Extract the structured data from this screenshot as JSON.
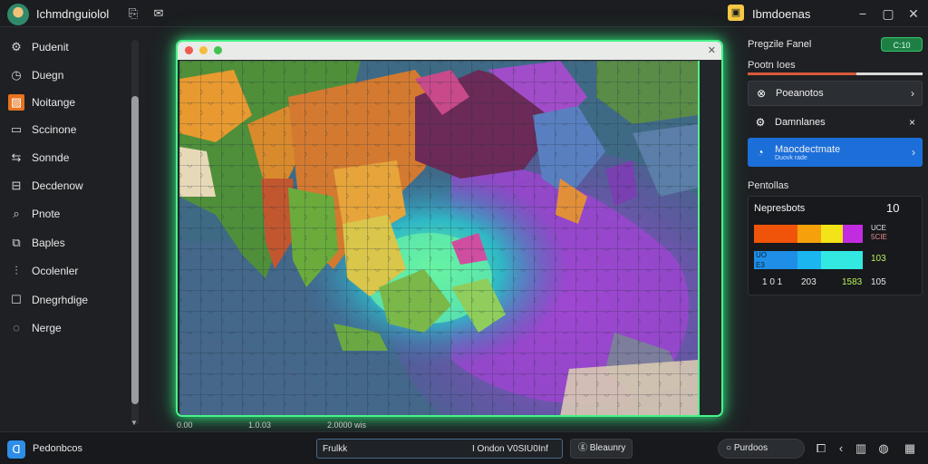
{
  "app": {
    "title": "Ichmdnguiolol",
    "logo_icon": "avatar-icon"
  },
  "right_header": {
    "title": "Ibmdoenas",
    "icon": "folder-icon"
  },
  "sidebar": {
    "items": [
      {
        "label": "Pudenit",
        "icon": "gear-icon"
      },
      {
        "label": "Duegn",
        "icon": "clock-icon"
      },
      {
        "label": "Noitange",
        "icon": "image-icon",
        "active": true
      },
      {
        "label": "Sccinone",
        "icon": "chat-icon"
      },
      {
        "label": "Sonnde",
        "icon": "share-icon"
      },
      {
        "label": "Decdenow",
        "icon": "inbox-icon"
      },
      {
        "label": "Pnote",
        "icon": "pin-icon"
      },
      {
        "label": "Baples",
        "icon": "layers-icon"
      },
      {
        "label": "Ocolenler",
        "icon": "sliders-icon"
      },
      {
        "label": "Dnegrhdige",
        "icon": "square-icon"
      },
      {
        "label": "Nerge",
        "icon": "chat-bubble-icon"
      }
    ]
  },
  "puzzle": {
    "scale_labels": [
      "0.00",
      "1.0.03",
      "2.0000 wis"
    ]
  },
  "panel": {
    "title": "Pregzile Fanel",
    "toggle_label": "C:10",
    "progress_label": "Pootn Ioes",
    "progress": 0.62,
    "rows": [
      {
        "label": "Poeanotos",
        "icon": "grid-icon",
        "style": "dark"
      },
      {
        "label": "Damnlanes",
        "icon": "settings-icon",
        "style": "plain",
        "trailing": "×"
      },
      {
        "label": "Maocdectmate",
        "sub": "Duovk rade",
        "icon": "pie-icon",
        "style": "blue"
      }
    ],
    "section_label": "Pentollas",
    "stats": {
      "title": "Nepresbots",
      "count": "10",
      "row1_small": [
        "UCE",
        "5CIE"
      ],
      "row2_small": [
        "UO",
        "E3"
      ],
      "row2_value": "103",
      "footer": [
        "1 0 1",
        "203",
        "1583",
        "105"
      ],
      "colors_row1": [
        "#f0540a",
        "#f6a10c",
        "#f2e418",
        "#c22ce0"
      ],
      "colors_row2": [
        "#1f8ee6",
        "#1bb6f0",
        "#34e8e2"
      ]
    }
  },
  "bottom": {
    "title": "Pedonbcos",
    "search_value": "Frulkk",
    "status_text": "I Ondon V0SIU0Inf",
    "button_label": "Bleaunry",
    "search_pill": "Purdoos",
    "icons": [
      "puzzle-piece-icon",
      "back-icon",
      "columns-icon",
      "palette-icon",
      "grid-icon"
    ]
  }
}
